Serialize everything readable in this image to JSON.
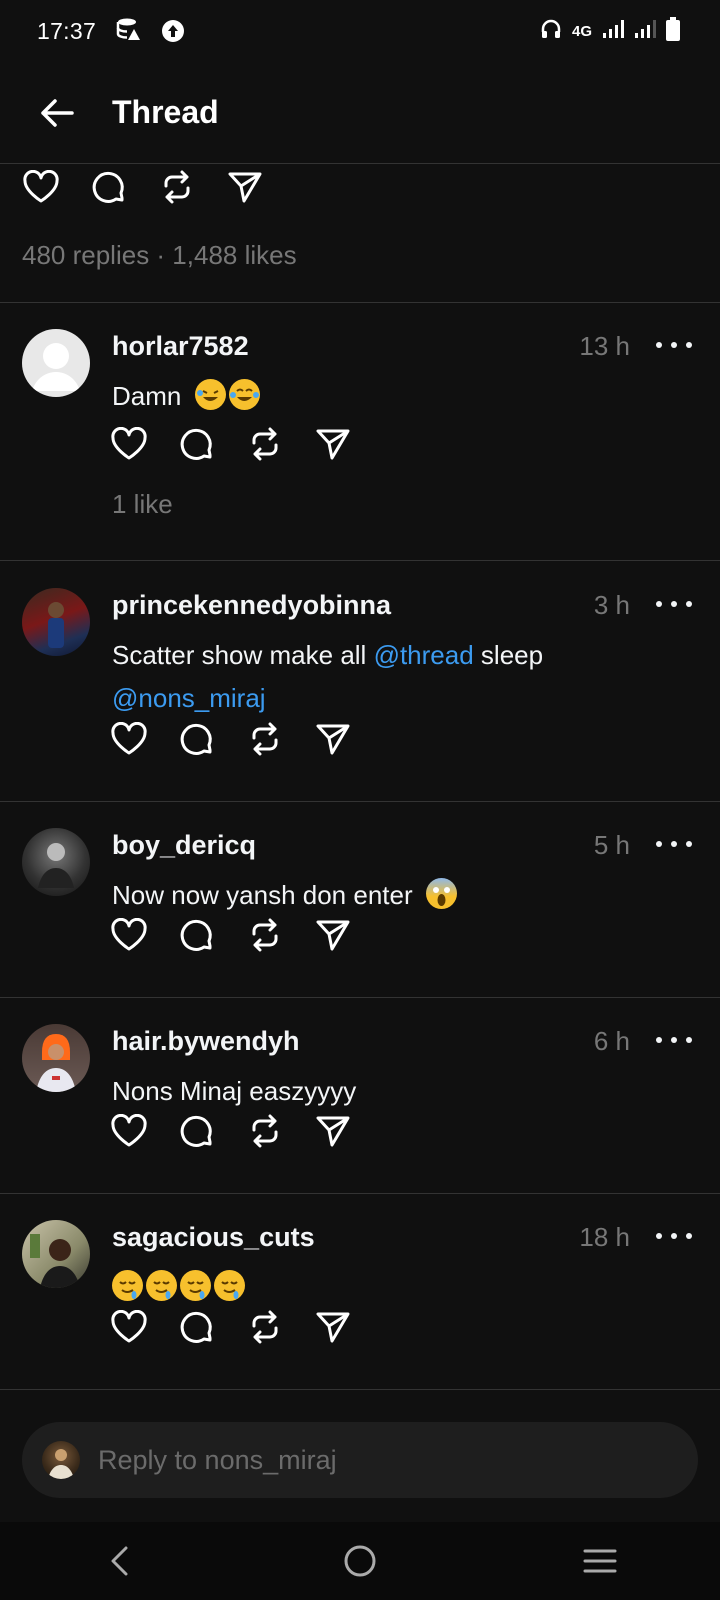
{
  "status_bar": {
    "time": "17:37",
    "network": "4G"
  },
  "header": {
    "title": "Thread"
  },
  "post": {
    "stats": "480 replies · 1,488 likes"
  },
  "replies": [
    {
      "username": "horlar7582",
      "time": "13 h",
      "text": "Damn",
      "emojis": [
        "rolling-on-floor-laughing-emoji",
        "tears-of-joy-emoji"
      ],
      "likes": "1 like"
    },
    {
      "username": "princekennedyobinna",
      "time": "3 h",
      "text_before": "Scatter show make all ",
      "mention1": "@thread",
      "text_after": " sleep",
      "mention2": "@nons_miraj"
    },
    {
      "username": "boy_dericq",
      "time": "5 h",
      "text": "Now now yansh don enter",
      "emojis": [
        "face-screaming-in-fear-emoji"
      ]
    },
    {
      "username": "hair.bywendyh",
      "time": "6 h",
      "text": "Nons Minaj easzyyyy"
    },
    {
      "username": "sagacious_cuts",
      "time": "18 h",
      "emojis": [
        "drooling-face-emoji",
        "drooling-face-emoji",
        "drooling-face-emoji",
        "drooling-face-emoji"
      ]
    }
  ],
  "reply_bar": {
    "placeholder": "Reply to nons_miraj"
  },
  "colors": {
    "background": "#101010",
    "mention": "#3c9bf0",
    "muted": "#777777"
  }
}
